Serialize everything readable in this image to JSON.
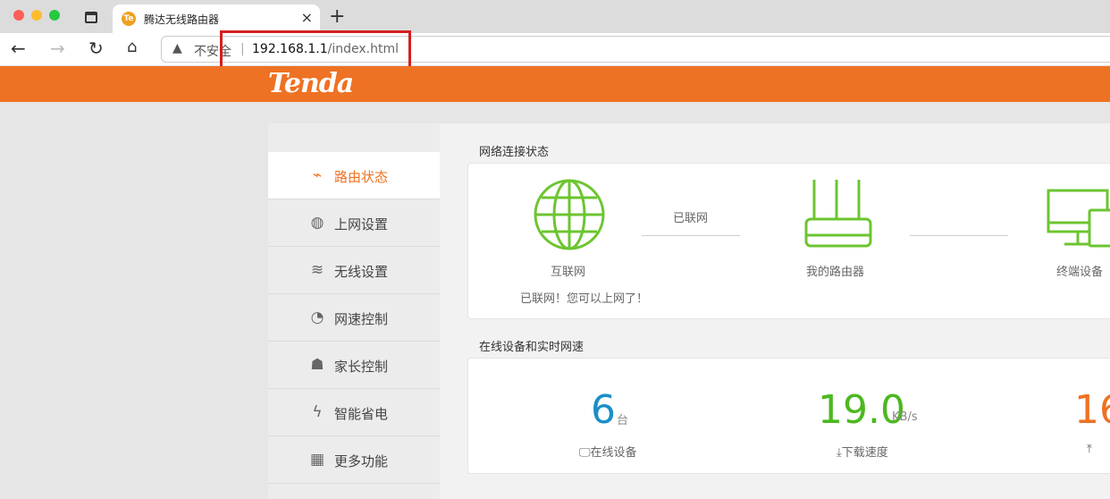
{
  "browser": {
    "tab_title": "腾达无线路由器",
    "tab_favicon": "Te",
    "security_label": "不安全",
    "url_host": "192.168.1.1",
    "url_path": "/index.html"
  },
  "header": {
    "logo": "Tenda",
    "color": "#ee7223"
  },
  "sidebar": {
    "items": [
      {
        "label": "路由状态",
        "icon": "pulse-icon",
        "active": true
      },
      {
        "label": "上网设置",
        "icon": "globe-icon"
      },
      {
        "label": "无线设置",
        "icon": "wifi-icon"
      },
      {
        "label": "网速控制",
        "icon": "speedometer-icon"
      },
      {
        "label": "家长控制",
        "icon": "family-icon"
      },
      {
        "label": "智能省电",
        "icon": "power-save-icon"
      },
      {
        "label": "更多功能",
        "icon": "grid-icon"
      }
    ]
  },
  "status": {
    "title": "网络连接状态",
    "internet": "互联网",
    "router": "我的路由器",
    "devices": "终端设备",
    "link_status": "已联网",
    "message": "已联网！您可以上网了！"
  },
  "realtime": {
    "title": "在线设备和实时网速",
    "online_count": "6",
    "online_unit": "台",
    "online_label": "在线设备",
    "download": "19.0",
    "download_unit": "KB/s",
    "download_label": "下载速度",
    "upload": "16"
  }
}
